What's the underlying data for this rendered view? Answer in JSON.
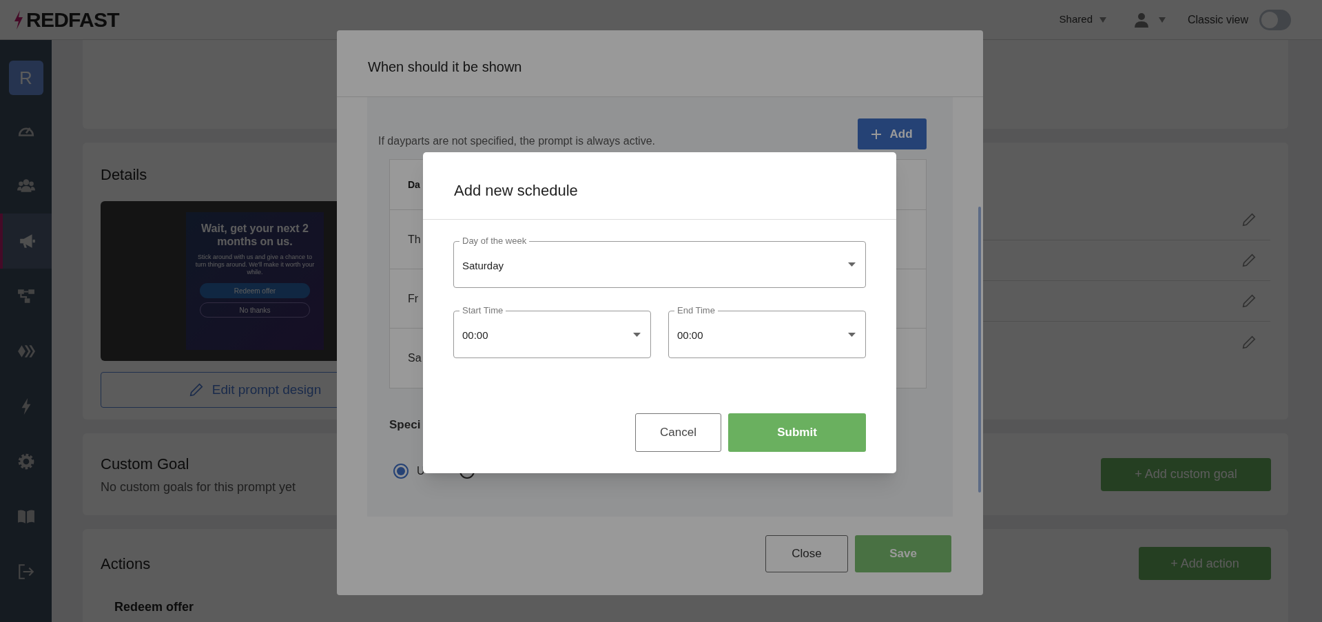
{
  "header": {
    "logo": "REDFAST",
    "menu": {
      "label": "Shared"
    },
    "classic_view": {
      "label": "Classic view",
      "on": false
    }
  },
  "sidebar": {
    "avatar": "R",
    "items": [
      {
        "kind": "gauge",
        "selected": false
      },
      {
        "kind": "users",
        "selected": false
      },
      {
        "kind": "megaphone",
        "selected": true
      },
      {
        "kind": "flow",
        "selected": false
      },
      {
        "kind": "chevrons",
        "selected": false
      },
      {
        "kind": "bolt",
        "selected": false
      },
      {
        "kind": "gear",
        "selected": false
      },
      {
        "kind": "book",
        "selected": false
      },
      {
        "kind": "logout",
        "selected": false
      }
    ]
  },
  "details": {
    "title": "Details",
    "preview": {
      "headline": "Wait, get your next 2 months on us.",
      "body": "Stick around with us and give a chance to turn things around. We'll make it worth your while.",
      "primary": "Redeem offer",
      "secondary": "No thanks"
    },
    "edit_button": "Edit prompt design",
    "rows": [
      {
        "kind": "editable"
      },
      {
        "kind": "editable"
      },
      {
        "kind": "editable"
      },
      {
        "kind": "editable"
      }
    ]
  },
  "custom_goal": {
    "title": "Custom Goal",
    "subtitle": "No custom goals for this prompt yet",
    "button": "+ Add custom goal"
  },
  "actions": {
    "title": "Actions",
    "button": "+ Add action",
    "items": [
      "Redeem offer"
    ]
  },
  "schedule_dialog": {
    "title": "When should it be shown",
    "hint": "If dayparts are not specified, the prompt is always active.",
    "add_button": "Add",
    "table": {
      "columns": [
        "Da"
      ],
      "rows": [
        "Th",
        "Fr",
        "Sa"
      ]
    },
    "section": "Speci",
    "radios": [
      {
        "label": "U",
        "selected": true
      },
      {
        "selected": false
      }
    ],
    "close_button": "Close",
    "save_button": "Save"
  },
  "new_schedule_dialog": {
    "title": "Add new schedule",
    "fields": [
      {
        "label": "Day of the week",
        "value": "Saturday"
      },
      {
        "label": "Start Time",
        "value": "00:00"
      },
      {
        "label": "End Time",
        "value": "00:00"
      }
    ],
    "cancel_button": "Cancel",
    "submit_button": "Submit"
  }
}
